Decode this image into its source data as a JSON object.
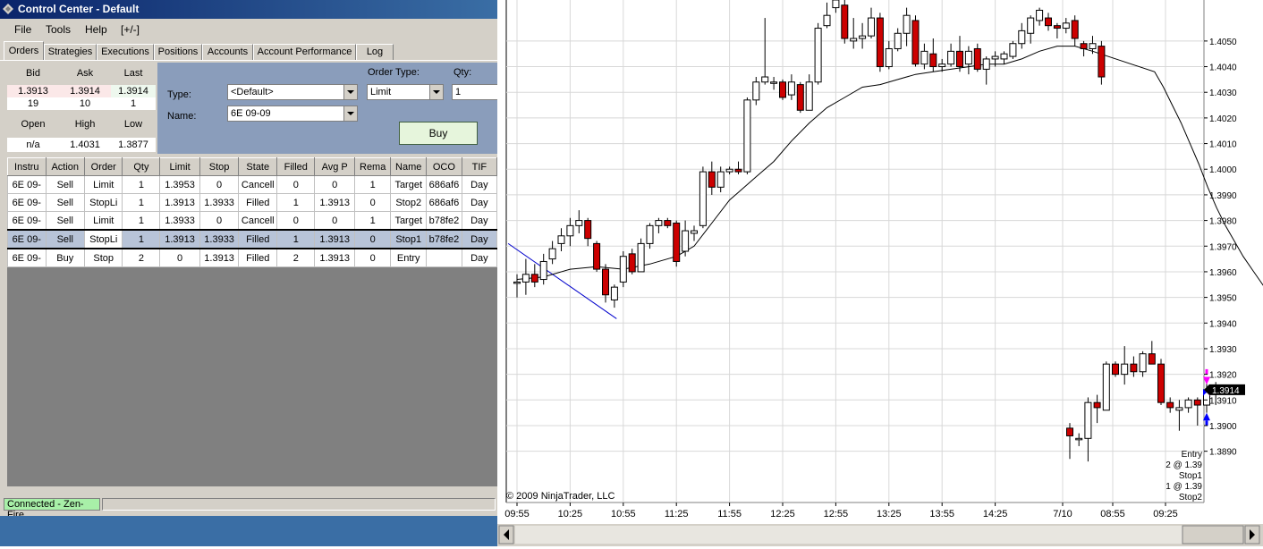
{
  "control_center": {
    "title": "Control Center - Default",
    "menu": [
      "File",
      "Tools",
      "Help",
      "[+/-]"
    ],
    "tabs": [
      "Orders",
      "Strategies",
      "Executions",
      "Positions",
      "Accounts",
      "Account Performance",
      "Log"
    ],
    "quote": {
      "bid_label": "Bid",
      "ask_label": "Ask",
      "last_label": "Last",
      "bid": "1.3913",
      "ask": "1.3914",
      "last": "1.3914",
      "bid_size": "19",
      "ask_size": "10",
      "last_size": "1",
      "open_label": "Open",
      "high_label": "High",
      "low_label": "Low",
      "open": "n/a",
      "high": "1.4031",
      "low": "1.3877"
    },
    "order_entry": {
      "type_label": "Type:",
      "type_value": "<Default>",
      "name_label": "Name:",
      "name_value": "6E 09-09",
      "order_type_label": "Order Type:",
      "order_type_value": "Limit",
      "qty_label": "Qty:",
      "qty_value": "1",
      "buy_label": "Buy"
    },
    "orders_table": {
      "columns": [
        "Instru",
        "Action",
        "Order",
        "Qty",
        "Limit",
        "Stop",
        "State",
        "Filled",
        "Avg P",
        "Rema",
        "Name",
        "OCO",
        "TIF"
      ],
      "rows": [
        [
          "6E 09-",
          "Sell",
          "Limit",
          "1",
          "1.3953",
          "0",
          "Cancell",
          "0",
          "0",
          "1",
          "Target",
          "686af6",
          "Day"
        ],
        [
          "6E 09-",
          "Sell",
          "StopLi",
          "1",
          "1.3913",
          "1.3933",
          "Filled",
          "1",
          "1.3913",
          "0",
          "Stop2",
          "686af6",
          "Day"
        ],
        [
          "6E 09-",
          "Sell",
          "Limit",
          "1",
          "1.3933",
          "0",
          "Cancell",
          "0",
          "0",
          "1",
          "Target",
          "b78fe2",
          "Day"
        ],
        [
          "6E 09-",
          "Sell",
          "StopLi",
          "1",
          "1.3913",
          "1.3933",
          "Filled",
          "1",
          "1.3913",
          "0",
          "Stop1",
          "b78fe2",
          "Day"
        ],
        [
          "6E 09-",
          "Buy",
          "Stop",
          "2",
          "0",
          "1.3913",
          "Filled",
          "2",
          "1.3913",
          "0",
          "Entry",
          "",
          "Day"
        ]
      ],
      "selected_row": 3
    },
    "status": "Connected - Zen-Fire"
  },
  "chart_data": {
    "type": "candlestick",
    "copyright": "© 2009 NinjaTrader, LLC",
    "x_tick_labels": [
      "09:55",
      "10:25",
      "10:55",
      "11:25",
      "11:55",
      "12:25",
      "12:55",
      "13:25",
      "13:55",
      "14:25",
      "7/10",
      "08:55",
      "09:25"
    ],
    "y_tick_labels": [
      "1.3890",
      "1.3900",
      "1.3910",
      "1.3920",
      "1.3930",
      "1.3940",
      "1.3950",
      "1.3960",
      "1.3970",
      "1.3980",
      "1.3990",
      "1.4000",
      "1.4010",
      "1.4020",
      "1.4030",
      "1.4040",
      "1.4050"
    ],
    "ylim": [
      1.387,
      1.4066
    ],
    "last_price": "1.3914",
    "colors": {
      "up": "#ffffff",
      "down": "#cc0000",
      "wick": "#000000",
      "sma": "#000000",
      "trendline": "#0000cc",
      "last_tag": "#000000",
      "entry_arrow": "#0000ff",
      "exit_arrow": "#ff00ff"
    },
    "candles": [
      [
        1.3956,
        1.3959,
        1.395,
        1.3956
      ],
      [
        1.3956,
        1.3965,
        1.3951,
        1.3959
      ],
      [
        1.3959,
        1.3963,
        1.3954,
        1.3956
      ],
      [
        1.3957,
        1.3967,
        1.3955,
        1.3964
      ],
      [
        1.3965,
        1.3972,
        1.3963,
        1.3969
      ],
      [
        1.3971,
        1.3977,
        1.3968,
        1.3974
      ],
      [
        1.3974,
        1.3981,
        1.397,
        1.3978
      ],
      [
        1.3978,
        1.3984,
        1.3975,
        1.398
      ],
      [
        1.398,
        1.3981,
        1.397,
        1.3973
      ],
      [
        1.3971,
        1.3972,
        1.396,
        1.3961
      ],
      [
        1.3961,
        1.3963,
        1.3948,
        1.3951
      ],
      [
        1.3949,
        1.3955,
        1.3946,
        1.3954
      ],
      [
        1.3956,
        1.3968,
        1.3954,
        1.3966
      ],
      [
        1.3967,
        1.3969,
        1.3959,
        1.396
      ],
      [
        1.396,
        1.3973,
        1.396,
        1.3971
      ],
      [
        1.3971,
        1.3979,
        1.3969,
        1.3978
      ],
      [
        1.3978,
        1.3981,
        1.3975,
        1.398
      ],
      [
        1.398,
        1.3981,
        1.3977,
        1.3978
      ],
      [
        1.3979,
        1.398,
        1.3962,
        1.3964
      ],
      [
        1.3968,
        1.398,
        1.3966,
        1.3976
      ],
      [
        1.3975,
        1.3978,
        1.3972,
        1.3976
      ],
      [
        1.3978,
        1.4001,
        1.3977,
        1.3999
      ],
      [
        1.3999,
        1.4003,
        1.399,
        1.3993
      ],
      [
        1.3993,
        1.4001,
        1.3991,
        1.3999
      ],
      [
        1.3999,
        1.4001,
        1.3998,
        1.4
      ],
      [
        1.4,
        1.4003,
        1.3998,
        1.3999
      ],
      [
        1.3999,
        1.4028,
        1.3998,
        1.4027
      ],
      [
        1.4027,
        1.4036,
        1.4025,
        1.4034
      ],
      [
        1.4034,
        1.4059,
        1.4033,
        1.4036
      ],
      [
        1.4034,
        1.4036,
        1.4031,
        1.4034
      ],
      [
        1.4034,
        1.4035,
        1.4027,
        1.4028
      ],
      [
        1.4029,
        1.4037,
        1.4027,
        1.4034
      ],
      [
        1.4033,
        1.4034,
        1.4022,
        1.4023
      ],
      [
        1.4023,
        1.4037,
        1.4023,
        1.4034
      ],
      [
        1.4034,
        1.4057,
        1.4033,
        1.4055
      ],
      [
        1.4056,
        1.4065,
        1.4055,
        1.406
      ],
      [
        1.4063,
        1.407,
        1.4061,
        1.4066
      ],
      [
        1.4064,
        1.407,
        1.4049,
        1.4051
      ],
      [
        1.405,
        1.4059,
        1.4047,
        1.4051
      ],
      [
        1.4051,
        1.4057,
        1.4047,
        1.4052
      ],
      [
        1.4052,
        1.4063,
        1.4051,
        1.4059
      ],
      [
        1.4059,
        1.4061,
        1.4038,
        1.404
      ],
      [
        1.404,
        1.405,
        1.4039,
        1.4047
      ],
      [
        1.4047,
        1.4055,
        1.4046,
        1.4053
      ],
      [
        1.4053,
        1.4063,
        1.4048,
        1.406
      ],
      [
        1.4058,
        1.406,
        1.404,
        1.4041
      ],
      [
        1.4041,
        1.4049,
        1.4039,
        1.4046
      ],
      [
        1.4045,
        1.4051,
        1.4038,
        1.404
      ],
      [
        1.404,
        1.4043,
        1.4038,
        1.4041
      ],
      [
        1.4041,
        1.4049,
        1.404,
        1.4046
      ],
      [
        1.4046,
        1.4052,
        1.4038,
        1.404
      ],
      [
        1.4041,
        1.4048,
        1.4037,
        1.4046
      ],
      [
        1.4047,
        1.4049,
        1.4038,
        1.4039
      ],
      [
        1.4039,
        1.4044,
        1.4033,
        1.4043
      ],
      [
        1.4043,
        1.4046,
        1.404,
        1.4044
      ],
      [
        1.4043,
        1.4046,
        1.4041,
        1.4045
      ],
      [
        1.4044,
        1.405,
        1.4043,
        1.4049
      ],
      [
        1.4049,
        1.4057,
        1.4047,
        1.4054
      ],
      [
        1.4053,
        1.406,
        1.4049,
        1.4059
      ],
      [
        1.4058,
        1.4063,
        1.4056,
        1.4062
      ],
      [
        1.4059,
        1.4061,
        1.4054,
        1.4056
      ],
      [
        1.4056,
        1.4057,
        1.4051,
        1.4055
      ],
      [
        1.4055,
        1.4059,
        1.4053,
        1.4057
      ],
      [
        1.4058,
        1.406,
        1.4048,
        1.4051
      ],
      [
        1.4049,
        1.405,
        1.4044,
        1.4047
      ],
      [
        1.4047,
        1.4052,
        1.4045,
        1.4049
      ],
      [
        1.4048,
        1.405,
        1.4033,
        1.4036
      ],
      [
        1.3899,
        1.3901,
        1.3887,
        1.3896
      ],
      [
        1.3895,
        1.3897,
        1.3892,
        1.3895
      ],
      [
        1.3895,
        1.3911,
        1.3886,
        1.3909
      ],
      [
        1.3909,
        1.3912,
        1.3901,
        1.3907
      ],
      [
        1.3906,
        1.3925,
        1.3906,
        1.3924
      ],
      [
        1.3924,
        1.3925,
        1.3919,
        1.392
      ],
      [
        1.392,
        1.3931,
        1.3916,
        1.3924
      ],
      [
        1.3924,
        1.3927,
        1.3919,
        1.3921
      ],
      [
        1.3921,
        1.3929,
        1.3919,
        1.3928
      ],
      [
        1.3928,
        1.3933,
        1.3926,
        1.3924
      ],
      [
        1.3924,
        1.3926,
        1.3908,
        1.3909
      ],
      [
        1.3909,
        1.3911,
        1.3905,
        1.3907
      ],
      [
        1.3906,
        1.391,
        1.3898,
        1.3907
      ],
      [
        1.3907,
        1.3911,
        1.3905,
        1.391
      ],
      [
        1.391,
        1.3911,
        1.39,
        1.3908
      ],
      [
        1.3908,
        1.3917,
        1.3905,
        1.3913
      ],
      [
        1.3913,
        1.3917,
        1.3908,
        1.3914
      ]
    ],
    "sma": [
      [
        0,
        1.3957
      ],
      [
        3,
        1.3958
      ],
      [
        6,
        1.3961
      ],
      [
        9,
        1.3962
      ],
      [
        12,
        1.3961
      ],
      [
        15,
        1.3963
      ],
      [
        18,
        1.3966
      ],
      [
        20,
        1.397
      ],
      [
        22,
        1.3979
      ],
      [
        24,
        1.3988
      ],
      [
        25,
        1.3991
      ],
      [
        27,
        1.3997
      ],
      [
        29,
        1.4003
      ],
      [
        31,
        1.4011
      ],
      [
        33,
        1.4018
      ],
      [
        35,
        1.4024
      ],
      [
        37,
        1.4028
      ],
      [
        39,
        1.4032
      ],
      [
        41,
        1.4033
      ],
      [
        43,
        1.4035
      ],
      [
        45,
        1.4037
      ],
      [
        47,
        1.4038
      ],
      [
        49,
        1.4039
      ],
      [
        51,
        1.404
      ],
      [
        53,
        1.4041
      ],
      [
        55,
        1.4041
      ],
      [
        57,
        1.4043
      ],
      [
        59,
        1.4046
      ],
      [
        61,
        1.4048
      ],
      [
        63,
        1.4048
      ],
      [
        65,
        1.4046
      ],
      [
        67,
        1.4038
      ],
      [
        68,
        1.4032
      ],
      [
        69,
        1.4025
      ],
      [
        70,
        1.4018
      ],
      [
        71,
        1.401
      ],
      [
        72,
        1.4002
      ],
      [
        73,
        1.3993
      ],
      [
        74,
        1.3985
      ],
      [
        75,
        1.3978
      ],
      [
        76,
        1.3972
      ],
      [
        77,
        1.3966
      ],
      [
        78,
        1.3961
      ],
      [
        79,
        1.3956
      ],
      [
        80,
        1.3951
      ],
      [
        81,
        1.3947
      ],
      [
        82,
        1.3943
      ]
    ],
    "trendline": [
      [
        -1,
        1.3971
      ],
      [
        7,
        1.3941
      ]
    ],
    "annotations": [
      "Entry",
      "2 @ 1.39",
      "Stop1",
      "1 @ 1.39",
      "Stop2"
    ]
  }
}
